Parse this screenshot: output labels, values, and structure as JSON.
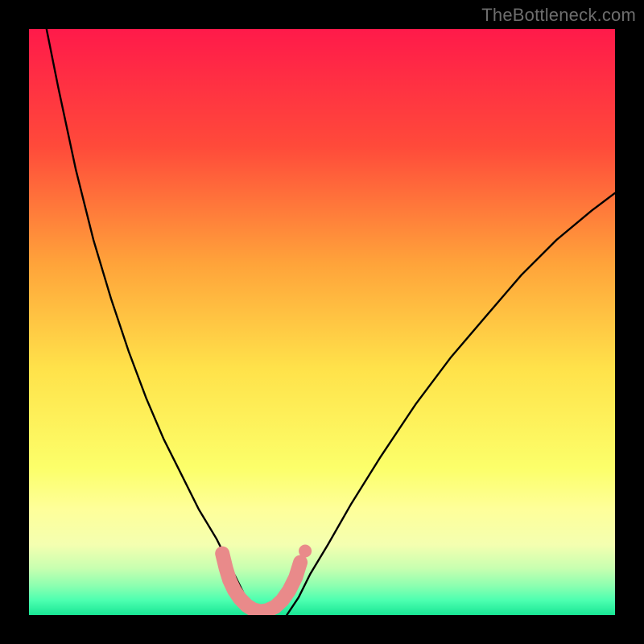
{
  "watermark": "TheBottleneck.com",
  "chart_data": {
    "type": "line",
    "title": "",
    "xlabel": "",
    "ylabel": "",
    "xlim": [
      0,
      100
    ],
    "ylim": [
      0,
      100
    ],
    "grid": false,
    "legend": false,
    "background": {
      "kind": "vertical-gradient",
      "stops": [
        {
          "pos": 0.0,
          "color": "#ff1a4a"
        },
        {
          "pos": 0.2,
          "color": "#ff4a3a"
        },
        {
          "pos": 0.4,
          "color": "#ffa33a"
        },
        {
          "pos": 0.58,
          "color": "#ffe24a"
        },
        {
          "pos": 0.75,
          "color": "#fcff6a"
        },
        {
          "pos": 0.82,
          "color": "#feff9a"
        },
        {
          "pos": 0.88,
          "color": "#f4ffb0"
        },
        {
          "pos": 0.92,
          "color": "#c8ffb0"
        },
        {
          "pos": 0.95,
          "color": "#8cffb0"
        },
        {
          "pos": 0.975,
          "color": "#4cffb0"
        },
        {
          "pos": 1.0,
          "color": "#19e695"
        }
      ]
    },
    "series": [
      {
        "name": "curve-left",
        "stroke": "#000000",
        "x": [
          3,
          5,
          8,
          11,
          14,
          17,
          20,
          23,
          26,
          29,
          32,
          33.5,
          35,
          36.5,
          37.5,
          38.5
        ],
        "y": [
          100,
          90,
          76,
          64,
          54,
          45,
          37,
          30,
          24,
          18,
          13,
          10,
          7,
          4,
          2,
          0
        ]
      },
      {
        "name": "curve-right",
        "stroke": "#000000",
        "x": [
          44,
          46,
          48,
          51,
          55,
          60,
          66,
          72,
          78,
          84,
          90,
          96,
          100
        ],
        "y": [
          0,
          3,
          7,
          12,
          19,
          27,
          36,
          44,
          51,
          58,
          64,
          69,
          72
        ]
      },
      {
        "name": "marker-strip",
        "kind": "scatter",
        "color": "#e98a8a",
        "x": [
          33.0,
          33.6,
          34.2,
          35.0,
          36.0,
          37.2,
          38.3,
          39.5,
          40.7,
          42.0,
          43.2,
          44.4,
          45.5,
          46.3
        ],
        "y": [
          10.5,
          8.0,
          6.0,
          4.3,
          2.8,
          1.6,
          0.9,
          0.6,
          0.8,
          1.4,
          2.5,
          4.2,
          6.4,
          9.0
        ]
      }
    ]
  }
}
